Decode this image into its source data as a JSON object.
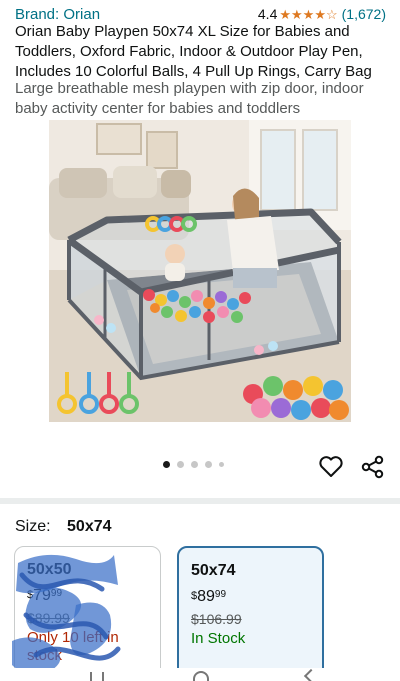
{
  "product": {
    "brand": "Brand: Orian",
    "rating": "4.4",
    "stars": [
      "★",
      "★",
      "★",
      "★",
      "☆"
    ],
    "review_count": "(1,672)",
    "title": "Orian Baby Playpen 50x74 XL Size for Babies and Toddlers, Oxford Fabric, Indoor & Outdoor Play Pen, Includes 10 Colorful Balls, 4 Pull Up Rings, Carry Bag",
    "subtitle": "Large breathable mesh playpen with zip door, indoor baby activity center for babies and toddlers"
  },
  "gallery": {
    "image_name": "playpen-photo",
    "dots": 5,
    "active_index": 0
  },
  "actions": {
    "heart_icon": "heart-icon",
    "share_icon": "share-icon"
  },
  "size": {
    "label": "Size:",
    "selected": "50x74",
    "options": [
      {
        "size": "50x50",
        "currency": "$",
        "price_whole": "79",
        "price_fraction": "99",
        "list_price": "$89.99",
        "stock": "Only 10 left in stock"
      },
      {
        "size": "50x74",
        "currency": "$",
        "price_whole": "89",
        "price_fraction": "99",
        "list_price": "$106.99",
        "stock": "In Stock"
      }
    ]
  },
  "colors": {
    "link": "#007185",
    "star": "#de7921",
    "in_stock": "#007600",
    "low_stock": "#b12704",
    "selected_border": "#2f6f9f",
    "scribble": "#3a6fc8"
  }
}
